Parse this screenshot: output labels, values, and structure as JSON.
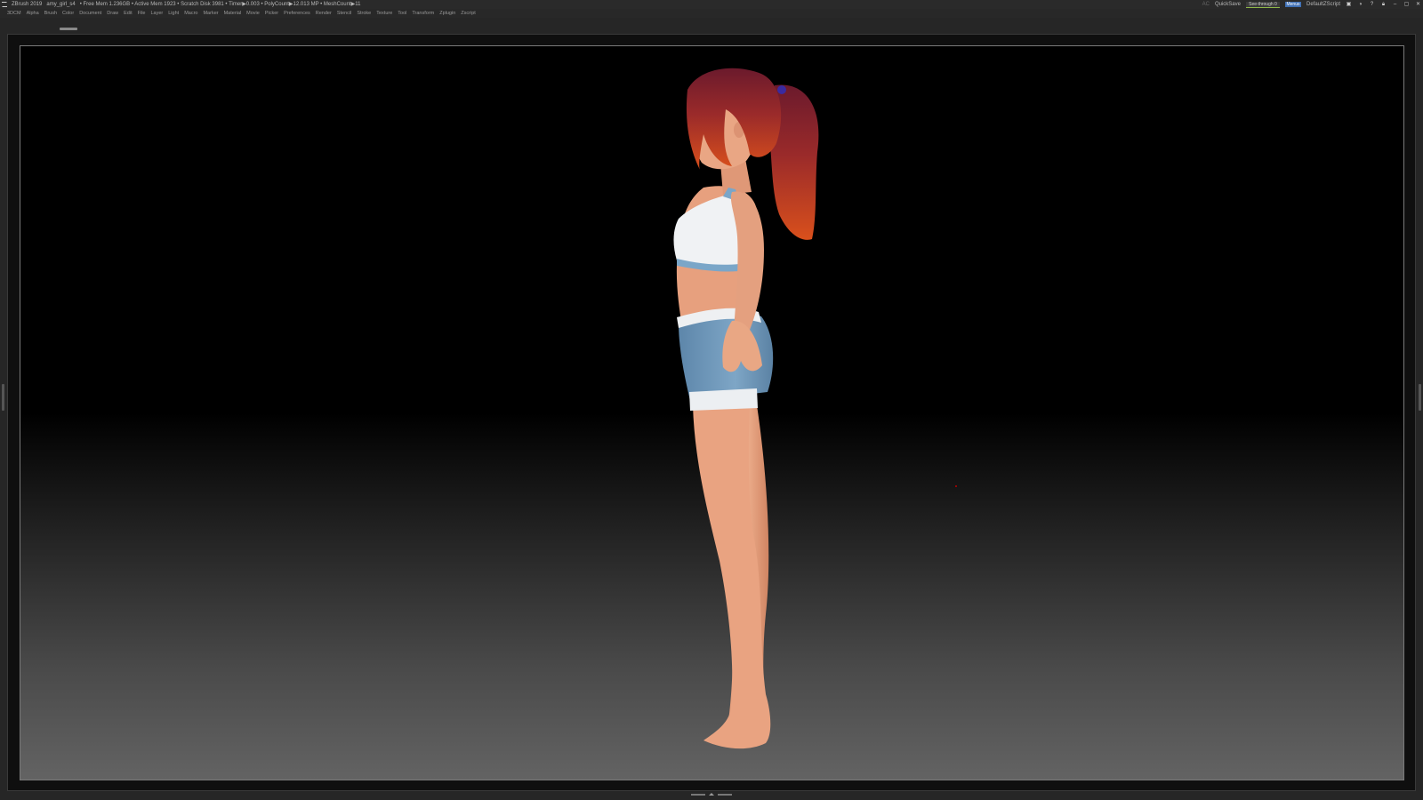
{
  "titlebar": {
    "app": "ZBrush 2019",
    "document": "amy_girl_s4",
    "stats": "• Free Mem 1.236GB • Active Mem 1923 • Scratch Disk 3981 • Timer▶0.003 • PolyCount▶12.013 MP • MeshCount▶11",
    "ac_label": "AC",
    "quicksave_label": "QuickSave",
    "see_through_label": "See-through   0",
    "menus_label": "Menus",
    "script_label": "DefaultZScript"
  },
  "menubar": {
    "items": [
      "3DCM",
      "Alpha",
      "Brush",
      "Color",
      "Document",
      "Draw",
      "Edit",
      "File",
      "Layer",
      "Light",
      "Macro",
      "Marker",
      "Material",
      "Movie",
      "Picker",
      "Preferences",
      "Render",
      "Stencil",
      "Stroke",
      "Texture",
      "Tool",
      "Transform",
      "Zplugin",
      "Zscript"
    ]
  },
  "icons": {
    "logo": "zbrush-logo-icon",
    "window_controls": [
      "minimize-icon",
      "maximize-icon",
      "close-icon"
    ]
  },
  "colors": {
    "hair_top": "#7a1d2e",
    "hair_bottom": "#d3461b",
    "skin": "#e8a27f",
    "top_white": "#eef0f2",
    "shorts_blue": "#6f97b8",
    "menus_blue": "#3f6fb3"
  }
}
